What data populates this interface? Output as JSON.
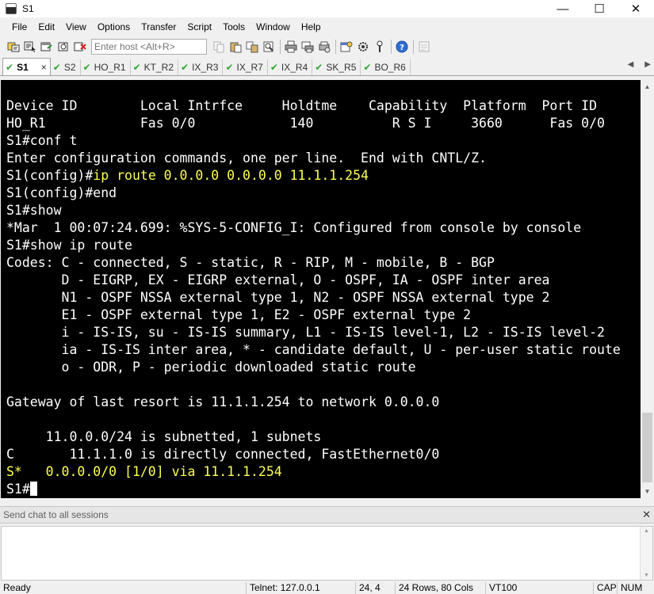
{
  "window": {
    "title": "S1",
    "minimize": "—",
    "maximize": "☐",
    "close": "✕"
  },
  "menu": [
    "File",
    "Edit",
    "View",
    "Options",
    "Transfer",
    "Script",
    "Tools",
    "Window",
    "Help"
  ],
  "toolbar": {
    "host_placeholder": "Enter host <Alt+R>"
  },
  "tabs": [
    {
      "label": "S1",
      "active": true,
      "close": "×"
    },
    {
      "label": "S2"
    },
    {
      "label": "HO_R1"
    },
    {
      "label": "KT_R2"
    },
    {
      "label": "IX_R3"
    },
    {
      "label": "IX_R7"
    },
    {
      "label": "IX_R4"
    },
    {
      "label": "SK_R5"
    },
    {
      "label": "BO_R6"
    }
  ],
  "tab_arrows": {
    "left": "◀",
    "right": "▶"
  },
  "terminal": {
    "lines": [
      "Device ID        Local Intrfce     Holdtme    Capability  Platform  Port ID",
      "HO_R1            Fas 0/0            140          R S I     3660      Fas 0/0",
      "S1#conf t",
      "Enter configuration commands, one per line.  End with CNTL/Z.",
      {
        "prefix": "S1(config)#",
        "highlight": "ip route 0.0.0.0 0.0.0.0 11.1.1.254"
      },
      "S1(config)#end",
      "S1#show",
      "*Mar  1 00:07:24.699: %SYS-5-CONFIG_I: Configured from console by console",
      "S1#show ip route",
      "Codes: C - connected, S - static, R - RIP, M - mobile, B - BGP",
      "       D - EIGRP, EX - EIGRP external, O - OSPF, IA - OSPF inter area",
      "       N1 - OSPF NSSA external type 1, N2 - OSPF NSSA external type 2",
      "       E1 - OSPF external type 1, E2 - OSPF external type 2",
      "       i - IS-IS, su - IS-IS summary, L1 - IS-IS level-1, L2 - IS-IS level-2",
      "       ia - IS-IS inter area, * - candidate default, U - per-user static route",
      "       o - ODR, P - periodic downloaded static route",
      "",
      "Gateway of last resort is 11.1.1.254 to network 0.0.0.0",
      "",
      "     11.0.0.0/24 is subnetted, 1 subnets",
      "C       11.1.1.0 is directly connected, FastEthernet0/0",
      {
        "highlight": "S*   0.0.0.0/0 [1/0] via 11.1.1.254"
      },
      {
        "prefix": "S1#",
        "cursor": true
      }
    ]
  },
  "scrollbar": {
    "up": "▲",
    "down": "▼"
  },
  "chat": {
    "title": "Send chat to all sessions",
    "close": "✕",
    "up": "▲",
    "down": "▼"
  },
  "status": {
    "state": "Ready",
    "connection": "Telnet: 127.0.0.1",
    "position": "24,   4",
    "size": "24 Rows, 80 Cols",
    "emulation": "VT100",
    "caps": "CAP",
    "num": "NUM"
  }
}
